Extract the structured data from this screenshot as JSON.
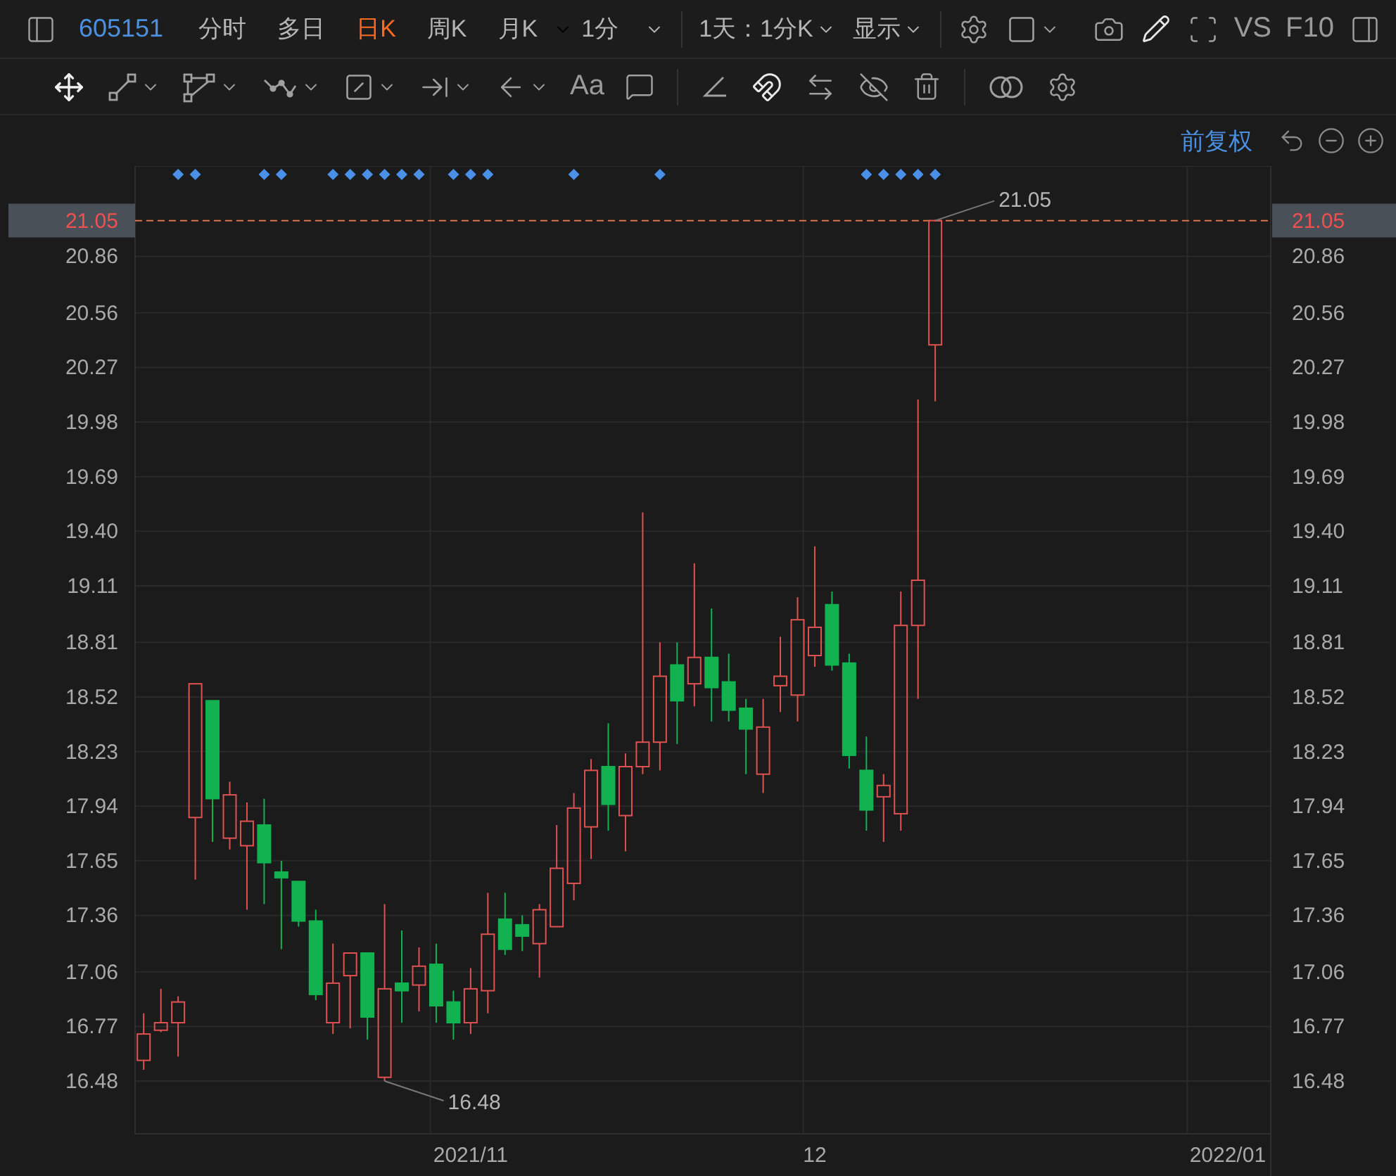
{
  "toolbar": {
    "symbol": "605151",
    "tabs": [
      {
        "label": "分时",
        "selected": false
      },
      {
        "label": "多日",
        "selected": false
      },
      {
        "label": "日K",
        "selected": true
      },
      {
        "label": "周K",
        "selected": false
      },
      {
        "label": "月K",
        "selected": false
      }
    ],
    "interval": "1分",
    "range": "1天：1分K",
    "display": "显示",
    "compare": [
      "VS",
      "F10"
    ]
  },
  "drawing_tools": {
    "text_tool": "Aa"
  },
  "chart": {
    "adjustment": "前复权",
    "price_line": {
      "left_label": "21.05",
      "right_label": "21.05"
    },
    "event_markers": [
      false,
      false,
      true,
      true,
      false,
      false,
      false,
      true,
      true,
      false,
      false,
      true,
      true,
      true,
      true,
      true,
      true,
      false,
      true,
      true,
      true,
      false,
      false,
      false,
      false,
      true,
      false,
      false,
      false,
      false,
      true,
      false,
      false,
      false,
      false,
      false,
      false,
      false,
      false,
      false,
      false,
      false,
      true,
      true,
      true,
      true,
      true
    ],
    "chart_data": {
      "type": "candlestick",
      "grid": true,
      "ylim": [
        16.2,
        21.34
      ],
      "categories": [
        null,
        null,
        null,
        null,
        null,
        null,
        null,
        null,
        null,
        null,
        null,
        null,
        null,
        null,
        null,
        null,
        null,
        null,
        null,
        "2021/11",
        null,
        null,
        null,
        null,
        null,
        null,
        null,
        null,
        null,
        null,
        null,
        null,
        null,
        null,
        null,
        null,
        null,
        null,
        null,
        "12",
        null,
        null,
        null,
        null,
        null,
        null,
        null,
        null,
        null,
        null,
        null,
        null,
        null,
        null,
        null,
        null,
        null,
        null,
        null,
        null,
        null,
        null,
        null,
        "2022/01",
        null,
        null
      ],
      "yticks": [
        {
          "value": 20.86,
          "label": "20.86"
        },
        {
          "value": 20.56,
          "label": "20.56"
        },
        {
          "value": 20.27,
          "label": "20.27"
        },
        {
          "value": 19.98,
          "label": "19.98"
        },
        {
          "value": 19.69,
          "label": "19.69"
        },
        {
          "value": 19.4,
          "label": "19.40"
        },
        {
          "value": 19.11,
          "label": "19.11"
        },
        {
          "value": 18.81,
          "label": "18.81"
        },
        {
          "value": 18.52,
          "label": "18.52"
        },
        {
          "value": 18.23,
          "label": "18.23"
        },
        {
          "value": 17.94,
          "label": "17.94"
        },
        {
          "value": 17.65,
          "label": "17.65"
        },
        {
          "value": 17.36,
          "label": "17.36"
        },
        {
          "value": 17.06,
          "label": "17.06"
        },
        {
          "value": 16.77,
          "label": "16.77"
        },
        {
          "value": 16.48,
          "label": "16.48"
        }
      ],
      "ohlc": [
        [
          16.59,
          16.84,
          16.54,
          16.73
        ],
        [
          16.75,
          16.97,
          16.74,
          16.79
        ],
        [
          16.79,
          16.93,
          16.61,
          16.9
        ],
        [
          17.88,
          18.59,
          17.55,
          18.59
        ],
        [
          18.5,
          18.5,
          17.75,
          17.98
        ],
        [
          17.77,
          18.07,
          17.71,
          18.0
        ],
        [
          17.73,
          17.96,
          17.39,
          17.86
        ],
        [
          17.84,
          17.98,
          17.42,
          17.64
        ],
        [
          17.59,
          17.65,
          17.18,
          17.56
        ],
        [
          17.54,
          17.54,
          17.3,
          17.33
        ],
        [
          17.33,
          17.39,
          16.91,
          16.94
        ],
        [
          16.79,
          17.21,
          16.73,
          17.0
        ],
        [
          17.04,
          17.16,
          16.76,
          17.16
        ],
        [
          17.16,
          17.16,
          16.7,
          16.82
        ],
        [
          16.5,
          17.42,
          16.48,
          16.97
        ],
        [
          17.0,
          17.28,
          16.79,
          16.96
        ],
        [
          16.99,
          17.19,
          16.85,
          17.09
        ],
        [
          17.1,
          17.21,
          16.79,
          16.88
        ],
        [
          16.9,
          16.96,
          16.7,
          16.79
        ],
        [
          16.79,
          17.08,
          16.73,
          16.97
        ],
        [
          16.96,
          17.48,
          16.84,
          17.26
        ],
        [
          17.34,
          17.48,
          17.15,
          17.18
        ],
        [
          17.31,
          17.36,
          17.17,
          17.25
        ],
        [
          17.21,
          17.42,
          17.03,
          17.39
        ],
        [
          17.3,
          17.84,
          17.3,
          17.61
        ],
        [
          17.53,
          18.01,
          17.44,
          17.93
        ],
        [
          17.83,
          18.19,
          17.66,
          18.13
        ],
        [
          18.15,
          18.38,
          17.81,
          17.95
        ],
        [
          17.89,
          18.22,
          17.7,
          18.15
        ],
        [
          18.15,
          19.5,
          18.11,
          18.28
        ],
        [
          18.28,
          18.81,
          18.13,
          18.63
        ],
        [
          18.69,
          18.81,
          18.27,
          18.5
        ],
        [
          18.59,
          19.23,
          18.47,
          18.73
        ],
        [
          18.73,
          18.99,
          18.39,
          18.57
        ],
        [
          18.6,
          18.75,
          18.39,
          18.45
        ],
        [
          18.46,
          18.51,
          18.11,
          18.35
        ],
        [
          18.11,
          18.51,
          18.01,
          18.36
        ],
        [
          18.58,
          18.84,
          18.44,
          18.63
        ],
        [
          18.53,
          19.05,
          18.39,
          18.93
        ],
        [
          18.74,
          19.32,
          18.68,
          18.89
        ],
        [
          19.01,
          19.08,
          18.66,
          18.69
        ],
        [
          18.7,
          18.75,
          18.14,
          18.21
        ],
        [
          18.13,
          18.31,
          17.81,
          17.92
        ],
        [
          17.99,
          18.11,
          17.75,
          18.05
        ],
        [
          17.9,
          19.08,
          17.81,
          18.9
        ],
        [
          18.9,
          20.1,
          18.51,
          19.14
        ],
        [
          20.39,
          21.05,
          20.09,
          21.05
        ],
        null,
        null,
        null,
        null,
        null,
        null,
        null,
        null,
        null,
        null,
        null,
        null,
        null,
        null,
        null,
        null,
        null,
        null,
        null
      ],
      "ref_lines": [
        {
          "axis": "y",
          "value": 21.05,
          "color": "#d9734a"
        }
      ],
      "annotations": [
        {
          "text": "21.05"
        },
        {
          "text": "16.48"
        }
      ]
    }
  }
}
